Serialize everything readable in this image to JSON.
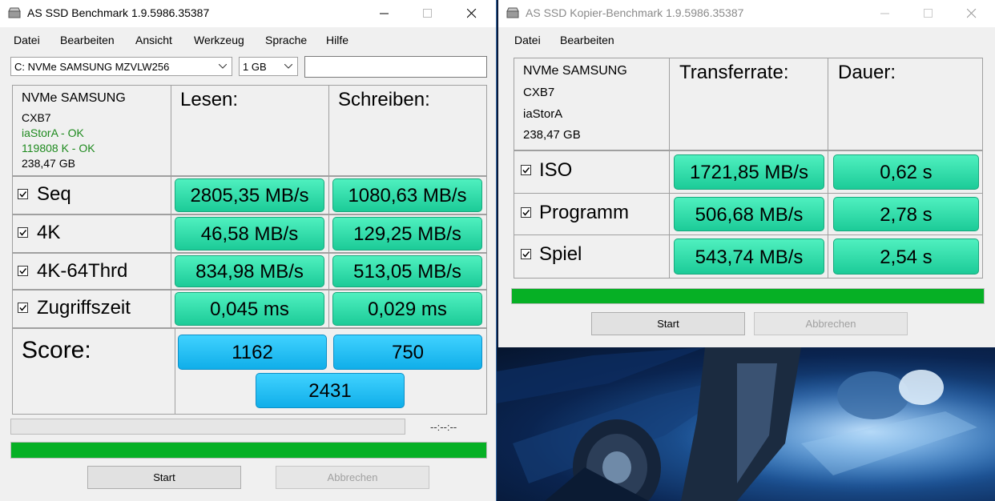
{
  "main": {
    "title": "AS SSD Benchmark 1.9.5986.35387",
    "menu": [
      "Datei",
      "Bearbeiten",
      "Ansicht",
      "Werkzeug",
      "Sprache",
      "Hilfe"
    ],
    "drive_select": "C: NVMe SAMSUNG MZVLW256",
    "size_select": "1 GB",
    "text_field": "",
    "drive_info": {
      "name": "NVMe SAMSUNG",
      "firmware": "CXB7",
      "driver": "iaStorA - OK",
      "alignment": "119808 K - OK",
      "capacity": "238,47 GB"
    },
    "headers": {
      "read": "Lesen:",
      "write": "Schreiben:"
    },
    "rows": [
      {
        "label": "Seq",
        "read": "2805,35 MB/s",
        "write": "1080,63 MB/s"
      },
      {
        "label": "4K",
        "read": "46,58 MB/s",
        "write": "129,25 MB/s"
      },
      {
        "label": "4K-64Thrd",
        "read": "834,98 MB/s",
        "write": "513,05 MB/s"
      },
      {
        "label": "Zugriffszeit",
        "read": "0,045 ms",
        "write": "0,029 ms"
      }
    ],
    "score": {
      "label": "Score:",
      "read": "1162",
      "write": "750",
      "total": "2431"
    },
    "elapsed": "--:--:--",
    "progress_fraction": 0.0,
    "progress2_fraction": 1.0,
    "start_label": "Start",
    "abort_label": "Abbrechen"
  },
  "copy": {
    "title": "AS SSD Kopier-Benchmark 1.9.5986.35387",
    "menu": [
      "Datei",
      "Bearbeiten"
    ],
    "drive_info": {
      "name": "NVMe SAMSUNG",
      "firmware": "CXB7",
      "driver": "iaStorA",
      "capacity": "238,47 GB"
    },
    "headers": {
      "rate": "Transferrate:",
      "duration": "Dauer:"
    },
    "rows": [
      {
        "label": "ISO",
        "rate": "1721,85 MB/s",
        "duration": "0,62 s"
      },
      {
        "label": "Programm",
        "rate": "506,68 MB/s",
        "duration": "2,78 s"
      },
      {
        "label": "Spiel",
        "rate": "543,74 MB/s",
        "duration": "2,54 s"
      }
    ],
    "progress_fraction": 1.0,
    "start_label": "Start",
    "abort_label": "Abbrechen"
  },
  "colors": {
    "result_green": "#2fe0ab",
    "score_blue": "#2ac3f5",
    "progress_green": "#06b025",
    "ok_text": "#1e8a1e"
  }
}
